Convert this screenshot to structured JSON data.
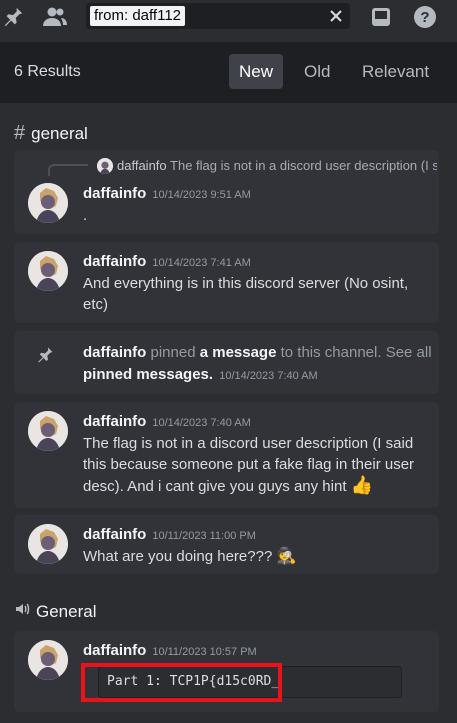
{
  "search": {
    "query": "from: daff112"
  },
  "results": {
    "count_label": "6 Results",
    "sort_tabs": [
      "New",
      "Old",
      "Relevant"
    ],
    "active_tab": "New"
  },
  "groups": [
    {
      "channel": "general",
      "messages": [
        {
          "reply_author": "daffainfo",
          "reply_text": "The flag is not in a discord user description (I s",
          "author": "daffainfo",
          "timestamp": "10/14/2023 9:51 AM",
          "text": "."
        },
        {
          "author": "daffainfo",
          "timestamp": "10/14/2023 7:41 AM",
          "text": "And everything is in this discord server (No osint, etc)"
        },
        {
          "system": true,
          "author": "daffainfo",
          "pinned_word": "pinned",
          "link1": "a message",
          "middle": "to this channel. See all",
          "link2": "pinned messages",
          "period": ".",
          "timestamp": "10/14/2023 7:40 AM"
        },
        {
          "author": "daffainfo",
          "timestamp": "10/14/2023 7:40 AM",
          "text": "The flag is not in a discord user description (I said this because someone put a fake flag in their user desc). And i cant give you guys any hint",
          "emoji": "👍"
        },
        {
          "author": "daffainfo",
          "timestamp": "10/11/2023 11:00 PM",
          "text": "What are you doing here???",
          "emoji": "🕵️"
        }
      ]
    },
    {
      "channel": "General",
      "channel_type": "voice",
      "messages": [
        {
          "author": "daffainfo",
          "timestamp": "10/11/2023 10:57 PM",
          "code": "Part 1: TCP1P{d15c0RD_"
        }
      ]
    }
  ],
  "colors": {
    "background": "#2b2d31",
    "header": "#1e1f22",
    "card": "#313338",
    "highlight": "#e8141b"
  }
}
